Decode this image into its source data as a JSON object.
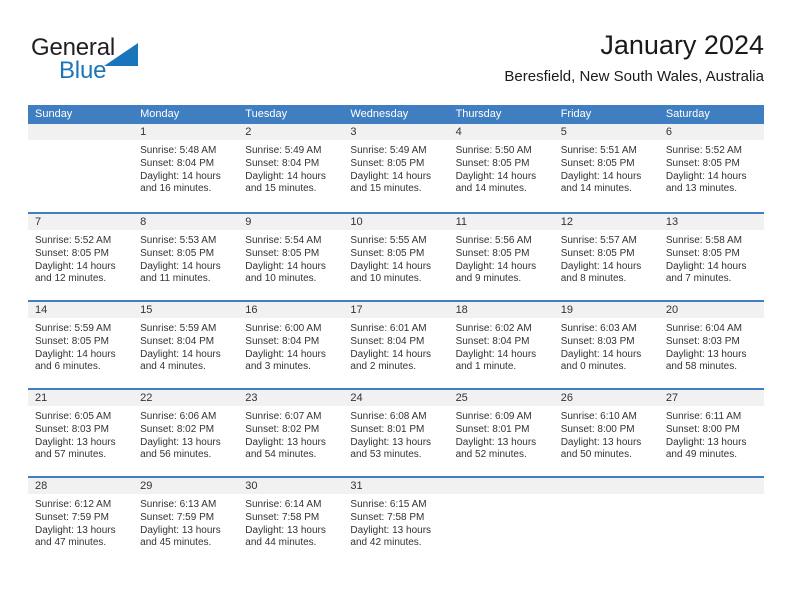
{
  "brand": {
    "word1": "General",
    "word2": "Blue",
    "accent_color": "#1b75bb"
  },
  "header": {
    "title": "January 2024",
    "subtitle": "Beresfield, New South Wales, Australia"
  },
  "calendar": {
    "header_color": "#3f7fc1",
    "weekdays": [
      "Sunday",
      "Monday",
      "Tuesday",
      "Wednesday",
      "Thursday",
      "Friday",
      "Saturday"
    ],
    "labels": {
      "sunrise": "Sunrise:",
      "sunset": "Sunset:",
      "daylight": "Daylight:"
    },
    "weeks": [
      [
        {
          "empty": true
        },
        {
          "day": "1",
          "sunrise": "Sunrise: 5:48 AM",
          "sunset": "Sunset: 8:04 PM",
          "daylight_1": "Daylight: 14 hours",
          "daylight_2": "and 16 minutes."
        },
        {
          "day": "2",
          "sunrise": "Sunrise: 5:49 AM",
          "sunset": "Sunset: 8:04 PM",
          "daylight_1": "Daylight: 14 hours",
          "daylight_2": "and 15 minutes."
        },
        {
          "day": "3",
          "sunrise": "Sunrise: 5:49 AM",
          "sunset": "Sunset: 8:05 PM",
          "daylight_1": "Daylight: 14 hours",
          "daylight_2": "and 15 minutes."
        },
        {
          "day": "4",
          "sunrise": "Sunrise: 5:50 AM",
          "sunset": "Sunset: 8:05 PM",
          "daylight_1": "Daylight: 14 hours",
          "daylight_2": "and 14 minutes."
        },
        {
          "day": "5",
          "sunrise": "Sunrise: 5:51 AM",
          "sunset": "Sunset: 8:05 PM",
          "daylight_1": "Daylight: 14 hours",
          "daylight_2": "and 14 minutes."
        },
        {
          "day": "6",
          "sunrise": "Sunrise: 5:52 AM",
          "sunset": "Sunset: 8:05 PM",
          "daylight_1": "Daylight: 14 hours",
          "daylight_2": "and 13 minutes."
        }
      ],
      [
        {
          "day": "7",
          "sunrise": "Sunrise: 5:52 AM",
          "sunset": "Sunset: 8:05 PM",
          "daylight_1": "Daylight: 14 hours",
          "daylight_2": "and 12 minutes."
        },
        {
          "day": "8",
          "sunrise": "Sunrise: 5:53 AM",
          "sunset": "Sunset: 8:05 PM",
          "daylight_1": "Daylight: 14 hours",
          "daylight_2": "and 11 minutes."
        },
        {
          "day": "9",
          "sunrise": "Sunrise: 5:54 AM",
          "sunset": "Sunset: 8:05 PM",
          "daylight_1": "Daylight: 14 hours",
          "daylight_2": "and 10 minutes."
        },
        {
          "day": "10",
          "sunrise": "Sunrise: 5:55 AM",
          "sunset": "Sunset: 8:05 PM",
          "daylight_1": "Daylight: 14 hours",
          "daylight_2": "and 10 minutes."
        },
        {
          "day": "11",
          "sunrise": "Sunrise: 5:56 AM",
          "sunset": "Sunset: 8:05 PM",
          "daylight_1": "Daylight: 14 hours",
          "daylight_2": "and 9 minutes."
        },
        {
          "day": "12",
          "sunrise": "Sunrise: 5:57 AM",
          "sunset": "Sunset: 8:05 PM",
          "daylight_1": "Daylight: 14 hours",
          "daylight_2": "and 8 minutes."
        },
        {
          "day": "13",
          "sunrise": "Sunrise: 5:58 AM",
          "sunset": "Sunset: 8:05 PM",
          "daylight_1": "Daylight: 14 hours",
          "daylight_2": "and 7 minutes."
        }
      ],
      [
        {
          "day": "14",
          "sunrise": "Sunrise: 5:59 AM",
          "sunset": "Sunset: 8:05 PM",
          "daylight_1": "Daylight: 14 hours",
          "daylight_2": "and 6 minutes."
        },
        {
          "day": "15",
          "sunrise": "Sunrise: 5:59 AM",
          "sunset": "Sunset: 8:04 PM",
          "daylight_1": "Daylight: 14 hours",
          "daylight_2": "and 4 minutes."
        },
        {
          "day": "16",
          "sunrise": "Sunrise: 6:00 AM",
          "sunset": "Sunset: 8:04 PM",
          "daylight_1": "Daylight: 14 hours",
          "daylight_2": "and 3 minutes."
        },
        {
          "day": "17",
          "sunrise": "Sunrise: 6:01 AM",
          "sunset": "Sunset: 8:04 PM",
          "daylight_1": "Daylight: 14 hours",
          "daylight_2": "and 2 minutes."
        },
        {
          "day": "18",
          "sunrise": "Sunrise: 6:02 AM",
          "sunset": "Sunset: 8:04 PM",
          "daylight_1": "Daylight: 14 hours",
          "daylight_2": "and 1 minute."
        },
        {
          "day": "19",
          "sunrise": "Sunrise: 6:03 AM",
          "sunset": "Sunset: 8:03 PM",
          "daylight_1": "Daylight: 14 hours",
          "daylight_2": "and 0 minutes."
        },
        {
          "day": "20",
          "sunrise": "Sunrise: 6:04 AM",
          "sunset": "Sunset: 8:03 PM",
          "daylight_1": "Daylight: 13 hours",
          "daylight_2": "and 58 minutes."
        }
      ],
      [
        {
          "day": "21",
          "sunrise": "Sunrise: 6:05 AM",
          "sunset": "Sunset: 8:03 PM",
          "daylight_1": "Daylight: 13 hours",
          "daylight_2": "and 57 minutes."
        },
        {
          "day": "22",
          "sunrise": "Sunrise: 6:06 AM",
          "sunset": "Sunset: 8:02 PM",
          "daylight_1": "Daylight: 13 hours",
          "daylight_2": "and 56 minutes."
        },
        {
          "day": "23",
          "sunrise": "Sunrise: 6:07 AM",
          "sunset": "Sunset: 8:02 PM",
          "daylight_1": "Daylight: 13 hours",
          "daylight_2": "and 54 minutes."
        },
        {
          "day": "24",
          "sunrise": "Sunrise: 6:08 AM",
          "sunset": "Sunset: 8:01 PM",
          "daylight_1": "Daylight: 13 hours",
          "daylight_2": "and 53 minutes."
        },
        {
          "day": "25",
          "sunrise": "Sunrise: 6:09 AM",
          "sunset": "Sunset: 8:01 PM",
          "daylight_1": "Daylight: 13 hours",
          "daylight_2": "and 52 minutes."
        },
        {
          "day": "26",
          "sunrise": "Sunrise: 6:10 AM",
          "sunset": "Sunset: 8:00 PM",
          "daylight_1": "Daylight: 13 hours",
          "daylight_2": "and 50 minutes."
        },
        {
          "day": "27",
          "sunrise": "Sunrise: 6:11 AM",
          "sunset": "Sunset: 8:00 PM",
          "daylight_1": "Daylight: 13 hours",
          "daylight_2": "and 49 minutes."
        }
      ],
      [
        {
          "day": "28",
          "sunrise": "Sunrise: 6:12 AM",
          "sunset": "Sunset: 7:59 PM",
          "daylight_1": "Daylight: 13 hours",
          "daylight_2": "and 47 minutes."
        },
        {
          "day": "29",
          "sunrise": "Sunrise: 6:13 AM",
          "sunset": "Sunset: 7:59 PM",
          "daylight_1": "Daylight: 13 hours",
          "daylight_2": "and 45 minutes."
        },
        {
          "day": "30",
          "sunrise": "Sunrise: 6:14 AM",
          "sunset": "Sunset: 7:58 PM",
          "daylight_1": "Daylight: 13 hours",
          "daylight_2": "and 44 minutes."
        },
        {
          "day": "31",
          "sunrise": "Sunrise: 6:15 AM",
          "sunset": "Sunset: 7:58 PM",
          "daylight_1": "Daylight: 13 hours",
          "daylight_2": "and 42 minutes."
        },
        {
          "empty": true
        },
        {
          "empty": true
        },
        {
          "empty": true
        }
      ]
    ]
  }
}
